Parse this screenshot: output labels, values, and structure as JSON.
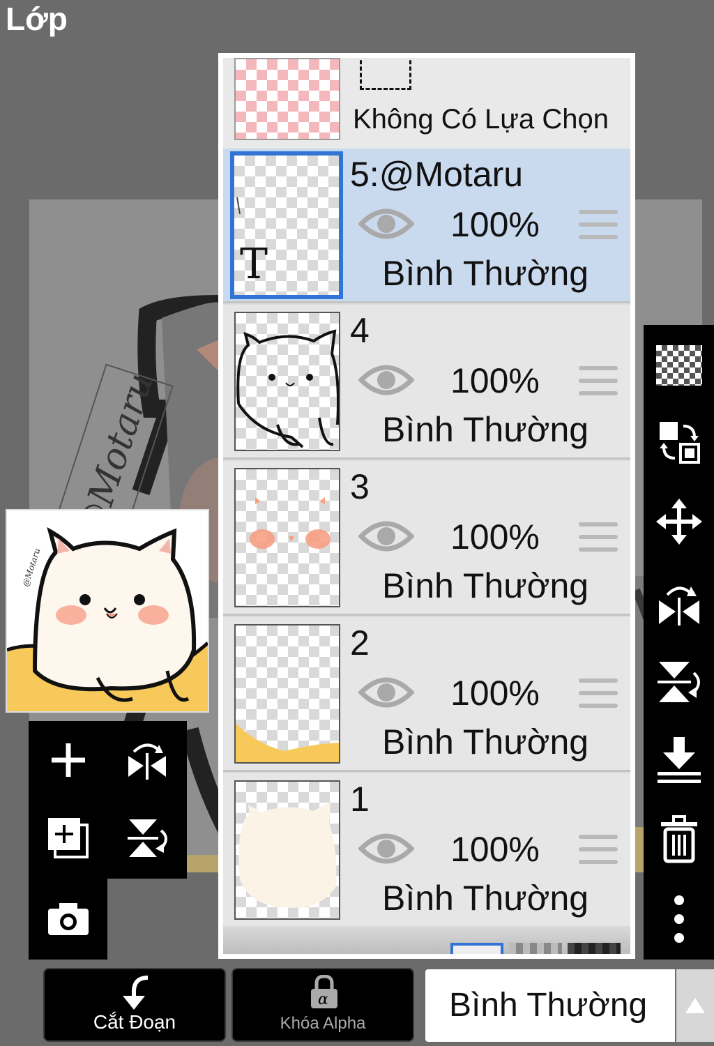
{
  "screen": {
    "title": "Lớp"
  },
  "selection": {
    "label": "Không Có Lựa Chọn"
  },
  "layers": [
    {
      "name": "5:@Motaru",
      "opacity": "100%",
      "blend": "Bình Thường",
      "selected": true,
      "thumbnail": "text-layer"
    },
    {
      "name": "4",
      "opacity": "100%",
      "blend": "Bình Thường",
      "selected": false,
      "thumbnail": "cat-lineart"
    },
    {
      "name": "3",
      "opacity": "100%",
      "blend": "Bình Thường",
      "selected": false,
      "thumbnail": "blush"
    },
    {
      "name": "2",
      "opacity": "100%",
      "blend": "Bình Thường",
      "selected": false,
      "thumbnail": "yellow-base"
    },
    {
      "name": "1",
      "opacity": "100%",
      "blend": "Bình Thường",
      "selected": false,
      "thumbnail": "cream-body"
    }
  ],
  "left_tools": [
    "add-layer-icon",
    "flip-horizontal-icon",
    "duplicate-layer-icon",
    "flip-vertical-icon",
    "camera-icon"
  ],
  "right_tools": [
    "transparent-bg-icon",
    "swap-layers-icon",
    "move-icon",
    "flip-horizontal-icon",
    "flip-vertical-icon",
    "merge-down-icon",
    "trash-icon",
    "more-icon"
  ],
  "bottom": {
    "clip_label": "Cắt Đoạn",
    "alpha_label": "Khóa Alpha",
    "blend_mode": "Bình Thường"
  },
  "watermark": "@Motaru",
  "colors": {
    "accent": "#2f74d6",
    "selected_row": "#c9d9ee",
    "cat_yellow": "#f6c95a",
    "cat_body": "#fdf7ee",
    "blush": "#f79a83"
  }
}
